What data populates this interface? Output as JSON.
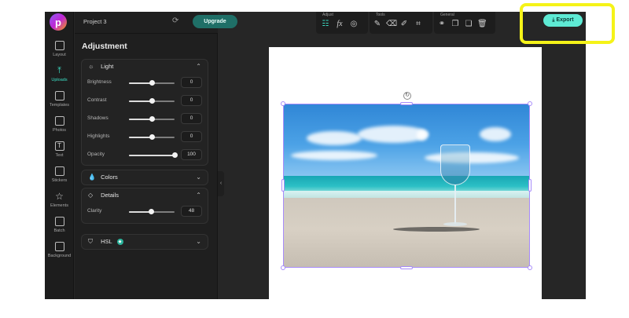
{
  "app": {
    "logo_letter": "p",
    "project_name": "Project 3",
    "upgrade_label": "Upgrade",
    "export_label": "Export"
  },
  "rail": [
    {
      "label": "Layout",
      "icon": "layout-icon"
    },
    {
      "label": "Uploads",
      "icon": "upload-icon",
      "active": true
    },
    {
      "label": "Templates",
      "icon": "book-icon"
    },
    {
      "label": "Photos",
      "icon": "image-icon"
    },
    {
      "label": "Text",
      "icon": "text-icon"
    },
    {
      "label": "Stickers",
      "icon": "sticker-icon"
    },
    {
      "label": "Elements",
      "icon": "star-icon"
    },
    {
      "label": "Batch",
      "icon": "batch-icon"
    },
    {
      "label": "Background",
      "icon": "background-icon"
    }
  ],
  "panel": {
    "title": "Adjustment",
    "light": {
      "label": "Light",
      "sliders": [
        {
          "name": "Brightness",
          "value": "0",
          "fraction": 0.5
        },
        {
          "name": "Contrast",
          "value": "0",
          "fraction": 0.5
        },
        {
          "name": "Shadows",
          "value": "0",
          "fraction": 0.5
        },
        {
          "name": "Highlights",
          "value": "0",
          "fraction": 0.5
        },
        {
          "name": "Opacity",
          "value": "100",
          "fraction": 1.0
        }
      ]
    },
    "colors_label": "Colors",
    "details": {
      "label": "Details",
      "sliders": [
        {
          "name": "Clarity",
          "value": "48",
          "fraction": 0.48
        }
      ]
    },
    "hsl_label": "HSL"
  },
  "toolbar": {
    "adjust_title": "Adjust",
    "tools_title": "Tools",
    "general_title": "General"
  },
  "colors": {
    "accent": "#3ce0c6",
    "export_bg": "#5eead4",
    "upgrade_bg": "#1f6f67",
    "highlight": "#f5f318",
    "selection": "#a78bfa"
  }
}
